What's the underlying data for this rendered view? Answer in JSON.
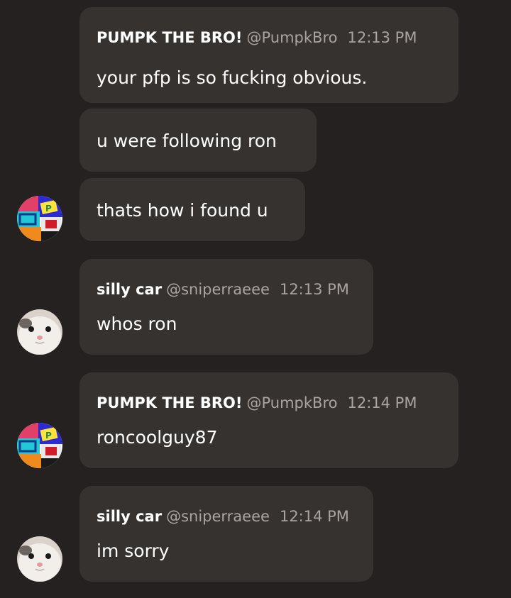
{
  "messages": [
    {
      "name": "PUMPK THE BRO!",
      "handle": "@PumpkBro",
      "time": "12:13 PM",
      "text": "your pfp is so fucking obvious."
    },
    {
      "text": "u were following ron"
    },
    {
      "text": "thats how i found u"
    },
    {
      "name": "silly car",
      "handle": "@sniperraeee",
      "time": "12:13 PM",
      "text": "whos ron"
    },
    {
      "name": "PUMPK THE BRO!",
      "handle": "@PumpkBro",
      "time": "12:14 PM",
      "text": "roncoolguy87"
    },
    {
      "name": "silly car",
      "handle": "@sniperraeee",
      "time": "12:14 PM",
      "text": "im sorry"
    }
  ],
  "icons": {
    "pumpk_avatar": "pumpk-avatar-icon",
    "cat_avatar": "cat-avatar-icon"
  },
  "colors": {
    "background": "#242120",
    "bubble": "#36322f",
    "text": "#ffffff",
    "muted": "#a9a4a0"
  }
}
